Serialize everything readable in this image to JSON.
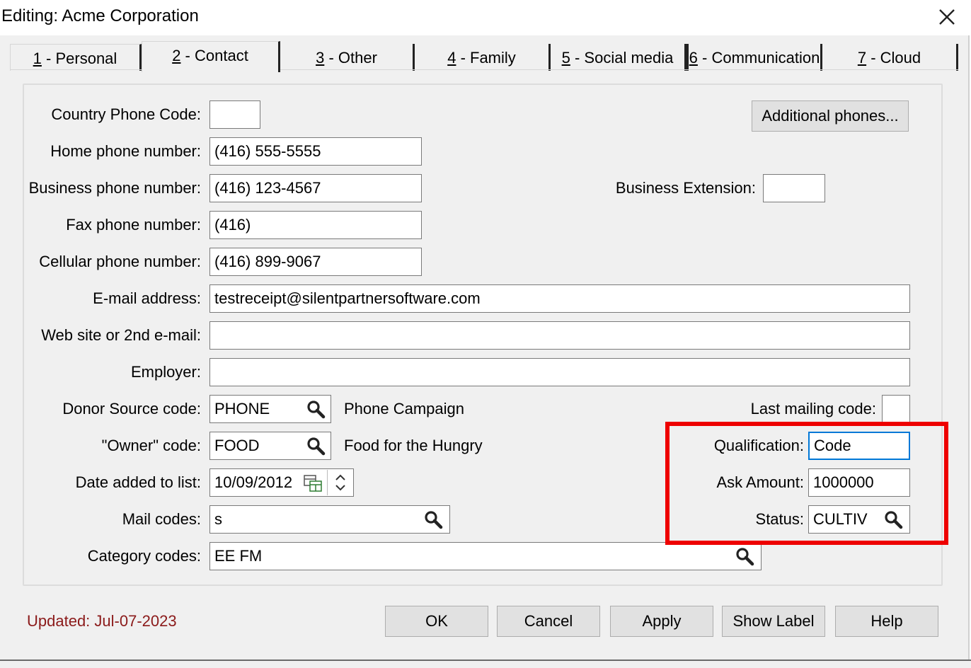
{
  "window": {
    "title": "Editing: Acme Corporation"
  },
  "tabs": [
    {
      "key": "1",
      "label": " - Personal"
    },
    {
      "key": "2",
      "label": " - Contact"
    },
    {
      "key": "3",
      "label": " - Other"
    },
    {
      "key": "4",
      "label": " - Family"
    },
    {
      "key": "5",
      "label": " - Social media"
    },
    {
      "key": "6",
      "label": " - Communication"
    },
    {
      "key": "7",
      "label": " - Cloud"
    }
  ],
  "active_tab": "2 - Contact",
  "contact": {
    "country_code_label": "Country Phone Code:",
    "country_code_value": "",
    "additional_phones_label": "Additional phones...",
    "home_phone_label": "Home phone number:",
    "home_phone_value": "(416) 555-5555",
    "business_phone_label": "Business phone number:",
    "business_phone_value": "(416) 123-4567",
    "business_ext_label": "Business Extension:",
    "business_ext_value": "",
    "fax_label": "Fax phone number:",
    "fax_value": "(416)",
    "cell_label": "Cellular phone number:",
    "cell_value": "(416) 899-9067",
    "email_label": "E-mail address:",
    "email_value": "testreceipt@silentpartnersoftware.com",
    "website_label": "Web site or 2nd e-mail:",
    "website_value": "",
    "employer_label": "Employer:",
    "employer_value": "",
    "donor_source_label": "Donor Source code:",
    "donor_source_value": "PHONE",
    "donor_source_desc": "Phone Campaign",
    "last_mailing_label": "Last mailing code:",
    "last_mailing_value": "",
    "owner_label": "\"Owner\" code:",
    "owner_value": "FOOD",
    "owner_desc": "Food for the Hungry",
    "qualification_label": "Qualification:",
    "qualification_value": "Code",
    "date_added_label": "Date added to list:",
    "date_added_value": "10/09/2012",
    "ask_amount_label": "Ask Amount:",
    "ask_amount_value": "1000000",
    "mail_codes_label": "Mail codes:",
    "mail_codes_value": "s",
    "status_label": "Status:",
    "status_value": "CULTIV",
    "category_label": "Category codes:",
    "category_value": "EE FM"
  },
  "footer": {
    "updated": "Updated: Jul-07-2023",
    "ok": "OK",
    "cancel": "Cancel",
    "apply": "Apply",
    "show_label": "Show Label",
    "help": "Help"
  },
  "colors": {
    "updated_text": "#8b1a1a",
    "highlight": "#ee0000",
    "focus_border": "#0078d7"
  },
  "icons": {
    "lookup": "magnifier-icon",
    "calendar": "calendar-icon",
    "close": "close-icon"
  }
}
